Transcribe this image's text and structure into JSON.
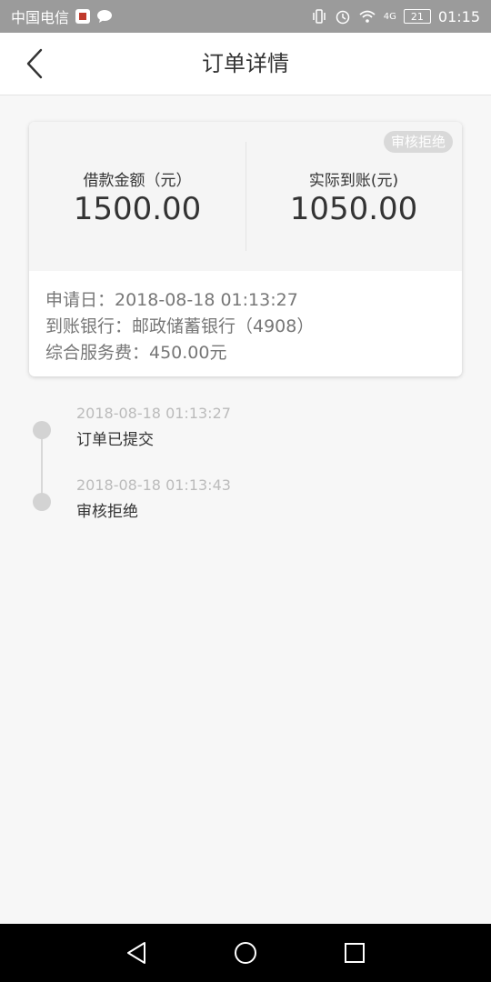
{
  "status_bar": {
    "carrier": "中国电信",
    "icons": [
      "app-badge-icon",
      "chat-bubble-icon",
      "vibrate-icon",
      "alarm-icon",
      "wifi-icon",
      "network-4g-icon"
    ],
    "network": "4G",
    "battery": "21",
    "time": "01:15"
  },
  "header": {
    "title": "订单详情"
  },
  "card": {
    "status_badge": "审核拒绝",
    "loan_amount_label": "借款金额（元）",
    "loan_amount_value": "1500.00",
    "received_label": "实际到账(元)",
    "received_value": "1050.00",
    "info": [
      "申请日：2018-08-18 01:13:27",
      "到账银行：邮政储蓄银行（4908）",
      "综合服务费：450.00元"
    ]
  },
  "timeline": [
    {
      "time": "2018-08-18 01:13:27",
      "text": "订单已提交"
    },
    {
      "time": "2018-08-18 01:13:43",
      "text": "审核拒绝"
    }
  ],
  "colors": {
    "status_bar": "#9b9b9b",
    "header_bg": "#ffffff",
    "page_bg": "#f7f7f7",
    "badge_bg": "#d9d9d9",
    "nav_bg": "#000000"
  }
}
